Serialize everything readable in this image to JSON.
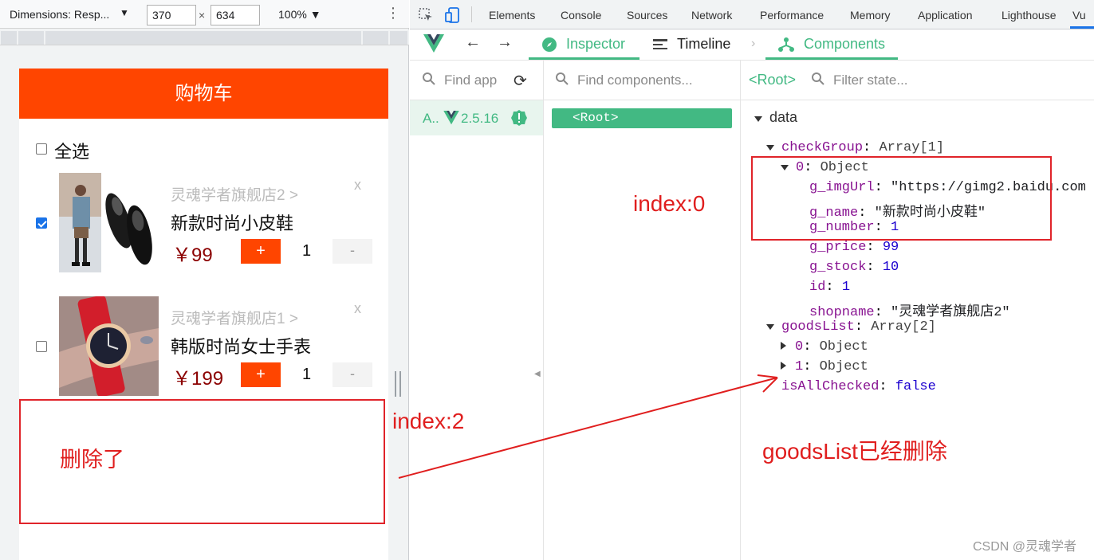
{
  "device_toolbar": {
    "dimensions_label": "Dimensions: Resp...",
    "width": "370",
    "times": "×",
    "height": "634",
    "zoom": "100%",
    "more": "⋮"
  },
  "app": {
    "header_title": "购物车",
    "select_all_label": "全选",
    "items": [
      {
        "shop": "灵魂学者旗舰店2 >",
        "name": "新款时尚小皮鞋",
        "price": "￥99",
        "qty": "1",
        "plus": "+",
        "minus": "-",
        "delete": "x",
        "checked": true
      },
      {
        "shop": "灵魂学者旗舰店1 >",
        "name": "韩版时尚女士手表",
        "price": "￥199",
        "qty": "1",
        "plus": "+",
        "minus": "-",
        "delete": "x",
        "checked": false
      }
    ]
  },
  "devtools": {
    "tabs": [
      "Elements",
      "Console",
      "Sources",
      "Network",
      "Performance",
      "Memory",
      "Application",
      "Lighthouse",
      "Vu"
    ]
  },
  "vue": {
    "inspector": "Inspector",
    "timeline": "Timeline",
    "components": "Components",
    "find_apps_placeholder": "Find app",
    "find_components_placeholder": "Find components...",
    "filter_state_placeholder": "Filter state...",
    "root_breadcrumb": "<Root>",
    "app_label": "A..",
    "version": "2.5.16",
    "root_node": "<Root>"
  },
  "state": {
    "section": "data",
    "check_group_key": "checkGroup",
    "check_group_val": "Array[1]",
    "obj0_key": "0",
    "obj0_val": "Object",
    "fields": [
      {
        "key": "g_imgUrl",
        "val": "\"https://gimg2.baidu.com"
      },
      {
        "key": "g_name",
        "val": "\"新款时尚小皮鞋\""
      },
      {
        "key": "g_number",
        "val": "1"
      },
      {
        "key": "g_price",
        "val": "99"
      },
      {
        "key": "g_stock",
        "val": "10"
      },
      {
        "key": "id",
        "val": "1"
      },
      {
        "key": "shopname",
        "val": "\"灵魂学者旗舰店2\""
      }
    ],
    "goods_list_key": "goodsList",
    "goods_list_val": "Array[2]",
    "gl0_key": "0",
    "gl0_val": "Object",
    "gl1_key": "1",
    "gl1_val": "Object",
    "all_checked_key": "isAllChecked",
    "all_checked_val": "false"
  },
  "annotations": {
    "index0": "index:0",
    "index2": "index:2",
    "deleted": "删除了",
    "goodslist_deleted": "goodsList已经删除"
  },
  "watermark": "CSDN @灵魂学者",
  "colors": {
    "brand_orange": "#ff4500",
    "vue_green": "#42b983",
    "annotation_red": "#e01e1e"
  }
}
